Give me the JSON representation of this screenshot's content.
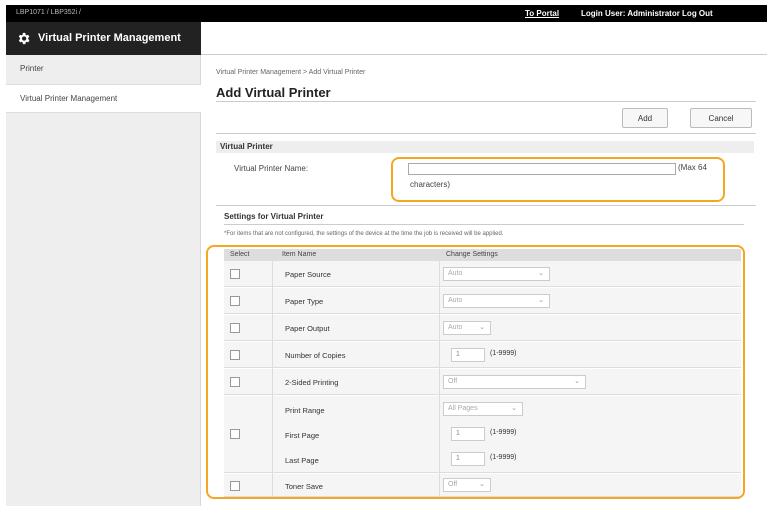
{
  "topbar": {
    "device_name": "LBP1071 / LBP352i /",
    "to_portal": "To Portal",
    "login_user": "Login User: Administrator Log Out"
  },
  "header": {
    "title": "Virtual Printer Management",
    "icon": "gear-icon"
  },
  "sidebar": {
    "items": [
      {
        "label": "Printer"
      },
      {
        "label": "Virtual Printer Management"
      }
    ]
  },
  "main": {
    "breadcrumb": "Virtual Printer Management > Add Virtual Printer",
    "title": "Add Virtual Printer",
    "add_label": "Add",
    "cancel_label": "Cancel",
    "virtual_printer": {
      "section_title": "Virtual Printer",
      "name_label": "Virtual Printer Name:",
      "name_value": "",
      "hint_line1": "(Max 64",
      "hint_line2": "characters)"
    },
    "settings": {
      "title": "Settings for Virtual Printer",
      "note": "*For items that are not configured, the settings of the device at the time the job is received will be applied.",
      "columns": [
        "Select",
        "Item Name",
        "Change Settings"
      ],
      "rows": [
        {
          "name": "Paper Source",
          "value": "Auto"
        },
        {
          "name": "Paper Type",
          "value": "Auto"
        },
        {
          "name": "Paper Output",
          "value": "Auto"
        },
        {
          "name": "Number of Copies",
          "value": "1",
          "range": "(1-9999)"
        },
        {
          "name": "2-Sided Printing",
          "value": "Off"
        },
        {
          "name": "Print Range",
          "value": "All Pages"
        },
        {
          "name": "First Page",
          "value": "1",
          "range": "(1-9999)"
        },
        {
          "name": "Last Page",
          "value": "1",
          "range": "(1-9999)"
        },
        {
          "name": "Toner Save",
          "value": "Off"
        }
      ]
    }
  },
  "colors": {
    "highlight": "#f5a623",
    "topbar": "#000000",
    "titlebar": "#222222",
    "sidebar": "#eeeeee"
  }
}
